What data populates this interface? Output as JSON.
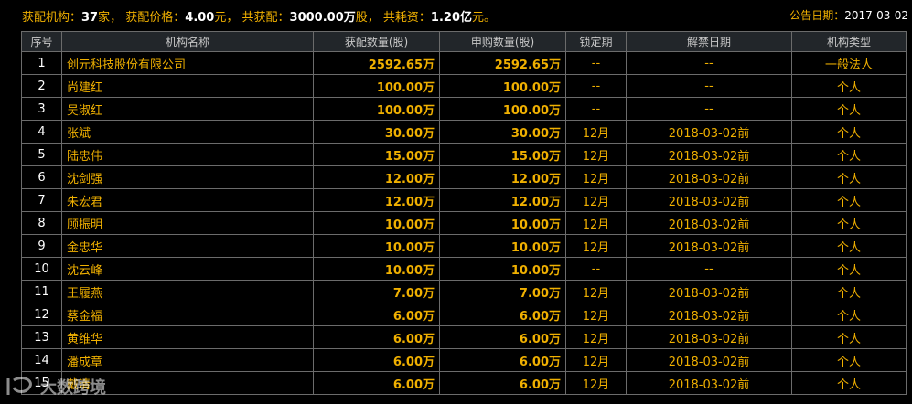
{
  "summary": {
    "label_institutions": "获配机构：",
    "institutions": "37",
    "unit_institutions": "家，",
    "label_price": "获配价格：",
    "price": "4.00",
    "unit_price": "元，",
    "label_total_alloc": "共获配：",
    "total_alloc": "3000.00万",
    "unit_total_alloc": "股，",
    "label_total_cost": "共耗资：",
    "total_cost": "1.20亿",
    "unit_total_cost": "元。"
  },
  "announce": {
    "label": "公告日期：",
    "date": "2017-03-02"
  },
  "columns": [
    "序号",
    "机构名称",
    "获配数量(股)",
    "申购数量(股)",
    "锁定期",
    "解禁日期",
    "机构类型"
  ],
  "rows": [
    {
      "no": "1",
      "name": "创元科技股份有限公司",
      "alloc": "2592.65万",
      "subscribe": "2592.65万",
      "lock": "--",
      "unlock": "--",
      "type": "一般法人"
    },
    {
      "no": "2",
      "name": "尚建红",
      "alloc": "100.00万",
      "subscribe": "100.00万",
      "lock": "--",
      "unlock": "--",
      "type": "个人"
    },
    {
      "no": "3",
      "name": "吴淑红",
      "alloc": "100.00万",
      "subscribe": "100.00万",
      "lock": "--",
      "unlock": "--",
      "type": "个人"
    },
    {
      "no": "4",
      "name": "张斌",
      "alloc": "30.00万",
      "subscribe": "30.00万",
      "lock": "12月",
      "unlock": "2018-03-02前",
      "type": "个人"
    },
    {
      "no": "5",
      "name": "陆忠伟",
      "alloc": "15.00万",
      "subscribe": "15.00万",
      "lock": "12月",
      "unlock": "2018-03-02前",
      "type": "个人"
    },
    {
      "no": "6",
      "name": "沈剑强",
      "alloc": "12.00万",
      "subscribe": "12.00万",
      "lock": "12月",
      "unlock": "2018-03-02前",
      "type": "个人"
    },
    {
      "no": "7",
      "name": "朱宏君",
      "alloc": "12.00万",
      "subscribe": "12.00万",
      "lock": "12月",
      "unlock": "2018-03-02前",
      "type": "个人"
    },
    {
      "no": "8",
      "name": "顾振明",
      "alloc": "10.00万",
      "subscribe": "10.00万",
      "lock": "12月",
      "unlock": "2018-03-02前",
      "type": "个人"
    },
    {
      "no": "9",
      "name": "金忠华",
      "alloc": "10.00万",
      "subscribe": "10.00万",
      "lock": "12月",
      "unlock": "2018-03-02前",
      "type": "个人"
    },
    {
      "no": "10",
      "name": "沈云峰",
      "alloc": "10.00万",
      "subscribe": "10.00万",
      "lock": "--",
      "unlock": "--",
      "type": "个人"
    },
    {
      "no": "11",
      "name": "王履燕",
      "alloc": "7.00万",
      "subscribe": "7.00万",
      "lock": "12月",
      "unlock": "2018-03-02前",
      "type": "个人"
    },
    {
      "no": "12",
      "name": "蔡金福",
      "alloc": "6.00万",
      "subscribe": "6.00万",
      "lock": "12月",
      "unlock": "2018-03-02前",
      "type": "个人"
    },
    {
      "no": "13",
      "name": "黄维华",
      "alloc": "6.00万",
      "subscribe": "6.00万",
      "lock": "12月",
      "unlock": "2018-03-02前",
      "type": "个人"
    },
    {
      "no": "14",
      "name": "潘成章",
      "alloc": "6.00万",
      "subscribe": "6.00万",
      "lock": "12月",
      "unlock": "2018-03-02前",
      "type": "个人"
    },
    {
      "no": "15",
      "name": "戴清",
      "alloc": "6.00万",
      "subscribe": "6.00万",
      "lock": "12月",
      "unlock": "2018-03-02前",
      "type": "个人"
    }
  ],
  "watermark": {
    "text": "大数跨境",
    "icon": "brand-logo-icon"
  },
  "colors": {
    "background": "#000000",
    "accent": "#f0b000",
    "header_bg": "#22262a",
    "border": "#6b6b6b"
  }
}
